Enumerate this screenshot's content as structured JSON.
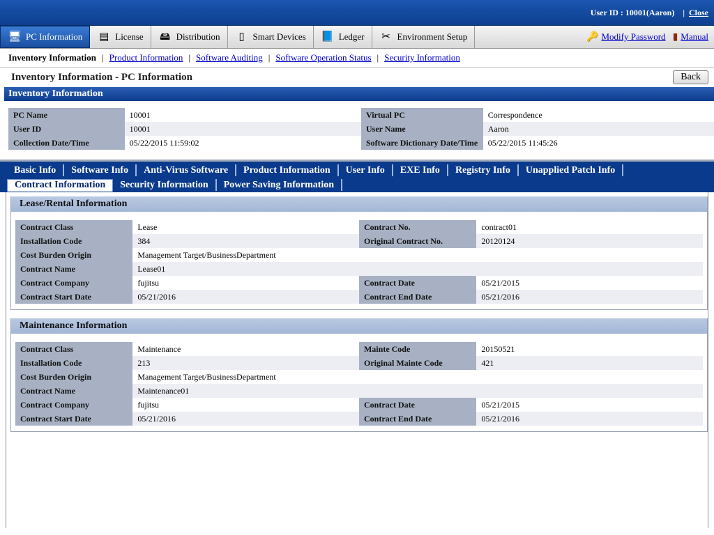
{
  "header": {
    "user_id": "User ID : 10001(Aaron)",
    "close": "Close"
  },
  "menu": {
    "items": [
      {
        "label": "PC Information",
        "icon": "pc-icon",
        "glyph": "🖥",
        "active": true
      },
      {
        "label": "License",
        "icon": "license-icon",
        "glyph": "▤"
      },
      {
        "label": "Distribution",
        "icon": "distribution-icon",
        "glyph": "🖴"
      },
      {
        "label": "Smart Devices",
        "icon": "smartphone-icon",
        "glyph": "▯"
      },
      {
        "label": "Ledger",
        "icon": "ledger-icon",
        "glyph": "📘"
      },
      {
        "label": "Environment Setup",
        "icon": "tools-icon",
        "glyph": "✂"
      }
    ],
    "modify_password": "Modify Password",
    "manual": "Manual"
  },
  "submenu": {
    "current": "Inventory Information",
    "links": [
      "Product Information",
      "Software Auditing",
      "Software Operation Status",
      "Security Information"
    ]
  },
  "page": {
    "title": "Inventory Information - PC Information",
    "back": "Back"
  },
  "inventory": {
    "heading": "Inventory Information",
    "rows": [
      [
        "PC Name",
        "10001",
        "Virtual PC",
        "Correspondence"
      ],
      [
        "User ID",
        "10001",
        "User Name",
        "Aaron"
      ],
      [
        "Collection Date/Time",
        "05/22/2015 11:59:02",
        "Software Dictionary Date/Time",
        "05/22/2015 11:45:26"
      ]
    ]
  },
  "tabs": {
    "row1": [
      "Basic Info",
      "Software Info",
      "Anti-Virus Software",
      "Product Information",
      "User Info",
      "EXE Info",
      "Registry Info",
      "Unapplied Patch Info"
    ],
    "row2": [
      "Contract Information",
      "Security Information",
      "Power Saving Information"
    ],
    "active": "Contract Information"
  },
  "lease": {
    "heading": "Lease/Rental Information",
    "rows": [
      [
        "Contract Class",
        "Lease",
        "Contract No.",
        "contract01"
      ],
      [
        "Installation Code",
        "384",
        "Original Contract No.",
        "20120124"
      ],
      [
        "Cost Burden Origin",
        "Management Target/BusinessDepartment"
      ],
      [
        "Contract Name",
        "Lease01"
      ],
      [
        "Contract Company",
        "fujitsu",
        "Contract Date",
        "05/21/2015"
      ],
      [
        "Contract Start Date",
        "05/21/2016",
        "Contract End Date",
        "05/21/2016"
      ]
    ]
  },
  "maintenance": {
    "heading": "Maintenance Information",
    "rows": [
      [
        "Contract Class",
        "Maintenance",
        "Mainte Code",
        "20150521"
      ],
      [
        "Installation Code",
        "213",
        "Original Mainte Code",
        "421"
      ],
      [
        "Cost Burden Origin",
        "Management Target/BusinessDepartment"
      ],
      [
        "Contract Name",
        "Maintenance01"
      ],
      [
        "Contract Company",
        "fujitsu",
        "Contract Date",
        "05/21/2015"
      ],
      [
        "Contract Start Date",
        "05/21/2016",
        "Contract End Date",
        "05/21/2016"
      ]
    ]
  }
}
